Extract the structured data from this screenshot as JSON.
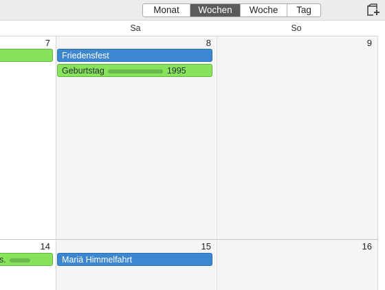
{
  "toolbar": {
    "views": [
      {
        "label": "Monat",
        "active": false
      },
      {
        "label": "Wochen",
        "active": true
      },
      {
        "label": "Woche",
        "active": false
      },
      {
        "label": "Tag",
        "active": false
      }
    ],
    "add_icon": "add-calendar-icon"
  },
  "day_headers": [
    "Sa",
    "So"
  ],
  "weeks": [
    {
      "days": [
        {
          "num": "7"
        },
        {
          "num": "8"
        },
        {
          "num": "9"
        }
      ],
      "events": {
        "sa": [
          {
            "title": "Friedensfest",
            "color": "#3d86d0"
          },
          {
            "title_prefix": "Geburtstag",
            "title_suffix": "1995",
            "color": "#89e25c"
          }
        ]
      }
    },
    {
      "days": [
        {
          "num": "14"
        },
        {
          "num": "15"
        },
        {
          "num": "16"
        }
      ],
      "events": {
        "fr_text": "s.",
        "sa": [
          {
            "title": "Mariä Himmelfahrt",
            "color": "#3d86d0"
          }
        ]
      }
    }
  ],
  "colors": {
    "blue_event": "#3d86d0",
    "green_event": "#89e25c",
    "weekend_bg": "#f5f5f5"
  }
}
